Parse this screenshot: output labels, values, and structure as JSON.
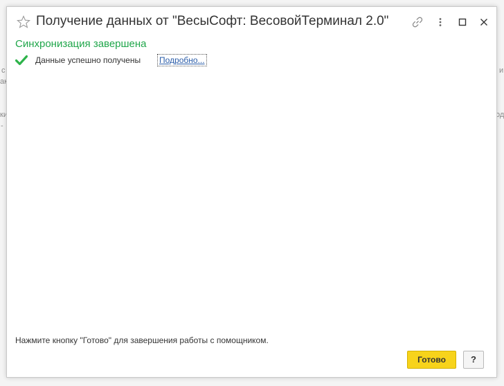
{
  "window": {
    "title": "Получение данных от \"ВесыСофт: ВесовойТерминал 2.0\""
  },
  "titlebar_icons": [
    "star-icon",
    "link-icon",
    "more-icon",
    "maximize-icon",
    "close-icon"
  ],
  "content": {
    "heading": "Синхронизация завершена",
    "status_text": "Данные успешно получены",
    "details_link": "Подробно..."
  },
  "footer": {
    "hint": "Нажмите кнопку \"Готово\" для завершения работы с помощником.",
    "done_label": "Готово",
    "help_label": "?"
  },
  "background_fragments": {
    "left_1": "с",
    "left_2": "ак",
    "left_3": "ки",
    "left_4": "-",
    "right_1": "и",
    "right_2": "од"
  },
  "colors": {
    "heading_green": "#1fa64a",
    "check_green": "#2db34a",
    "done_button_yellow": "#f7d31b",
    "link_blue": "#2a5ca8"
  }
}
